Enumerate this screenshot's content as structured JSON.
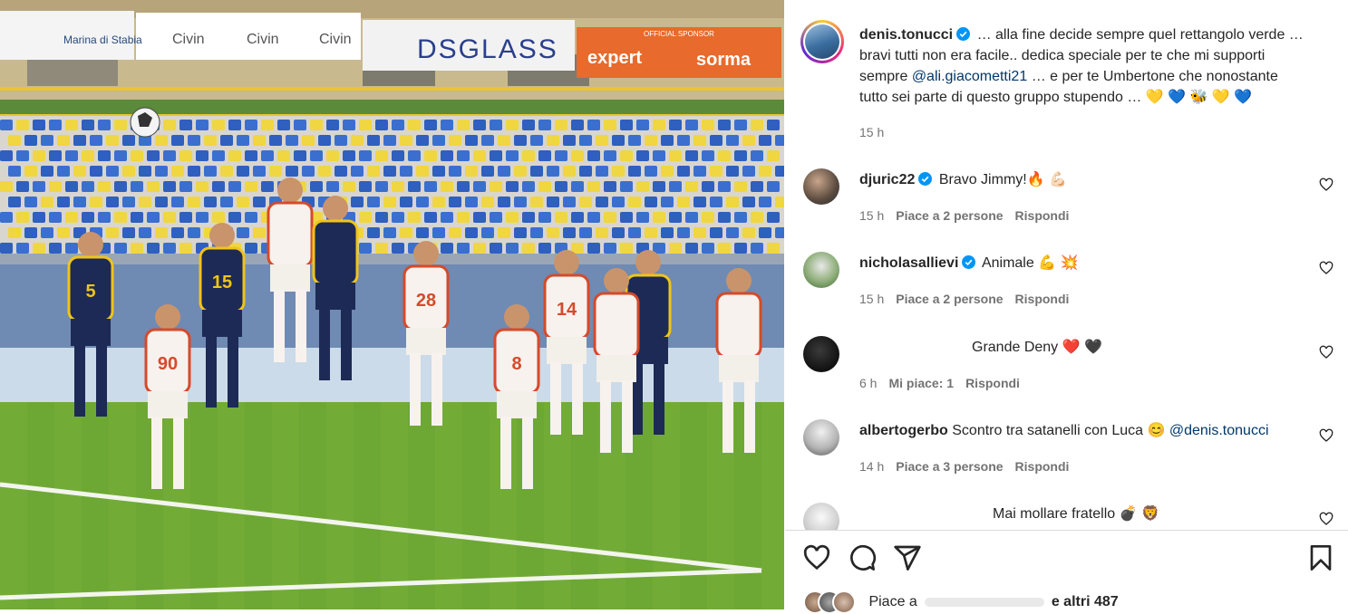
{
  "post": {
    "username": "denis.tonucci",
    "caption_lines": [
      "… alla fine decide sempre quel rettangolo verde …",
      "bravi tutti non era facile.. dedica speciale per te che mi supporti",
      "sempre",
      "… e per te Umbertone che nonostante",
      "tutto sei parte di questo gruppo stupendo … 💛 💙  🐝 💛 💙"
    ],
    "caption_mention": "@ali.giacometti21",
    "time": "15 h"
  },
  "photo": {
    "banners": [
      "Marina di Stabia",
      "Civin",
      "Civin",
      "Civin",
      "DSGLASS",
      "expert",
      "sorma",
      "OFFICIAL SPONSOR"
    ],
    "jersey_numbers": [
      "5",
      "15",
      "28",
      "14",
      "8",
      "90"
    ]
  },
  "comments": [
    {
      "username": "djuric22",
      "verified": true,
      "text": "Bravo Jimmy!🔥 💪🏻",
      "time": "15 h",
      "likes": "Piace a 2 persone",
      "reply": "Rispondi"
    },
    {
      "username": "nicholasallievi",
      "verified": true,
      "text": "Animale 💪 💥",
      "time": "15 h",
      "likes": "Piace a 2 persone",
      "reply": "Rispondi"
    },
    {
      "username": "",
      "verified": false,
      "text": "Grande Deny ❤️ 🖤",
      "time": "6 h",
      "likes": "Mi piace: 1",
      "reply": "Rispondi"
    },
    {
      "username": "albertogerbo",
      "verified": false,
      "text": "Scontro tra satanelli con Luca 😊",
      "mention": "@denis.tonucci",
      "time": "14 h",
      "likes": "Piace a 3 persone",
      "reply": "Rispondi"
    },
    {
      "username": "",
      "verified": false,
      "text": "Mai mollare fratello 💣 🦁"
    }
  ],
  "footer": {
    "likes_prefix": "Piace a",
    "likes_suffix": "e altri 487"
  },
  "icons": {
    "like": "heart-icon",
    "comment": "comment-icon",
    "share": "share-icon",
    "save": "bookmark-icon",
    "comment_like": "small-heart-icon",
    "verified": "verified-badge-icon"
  },
  "colors": {
    "verified": "#0095f6",
    "mention": "#00376b",
    "meta": "#737373"
  }
}
